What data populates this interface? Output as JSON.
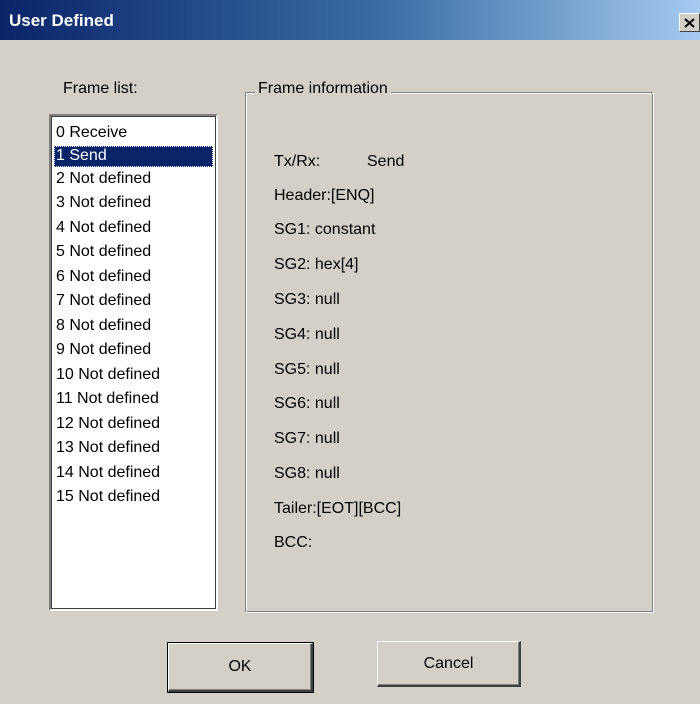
{
  "window": {
    "title": "User Defined",
    "close_label": "✕"
  },
  "frame_list": {
    "label": "Frame list:",
    "items": [
      "0 Receive",
      "1 Send",
      "2 Not defined",
      "3 Not defined",
      "4 Not defined",
      "5 Not defined",
      "6 Not defined",
      "7 Not defined",
      "8 Not defined",
      "9 Not defined",
      "10 Not defined",
      "11 Not defined",
      "12 Not defined",
      "13 Not defined",
      "14 Not defined",
      "15 Not defined"
    ],
    "selected_index": 1
  },
  "frame_info": {
    "legend": "Frame information",
    "txrx_label": "Tx/Rx:",
    "txrx_value": "Send",
    "header": "Header:[ENQ]",
    "sg1": "SG1: constant",
    "sg2": "SG2: hex[4]",
    "sg3": "SG3: null",
    "sg4": "SG4: null",
    "sg5": "SG5: null",
    "sg6": "SG6: null",
    "sg7": "SG7: null",
    "sg8": "SG8: null",
    "tailer": "Tailer:[EOT][BCC]",
    "bcc": "BCC:"
  },
  "buttons": {
    "ok": "OK",
    "cancel": "Cancel"
  },
  "colors": {
    "title_bar": "#0a246a",
    "selection": "#0a246a",
    "dialog_bg": "#d4d0c8"
  }
}
